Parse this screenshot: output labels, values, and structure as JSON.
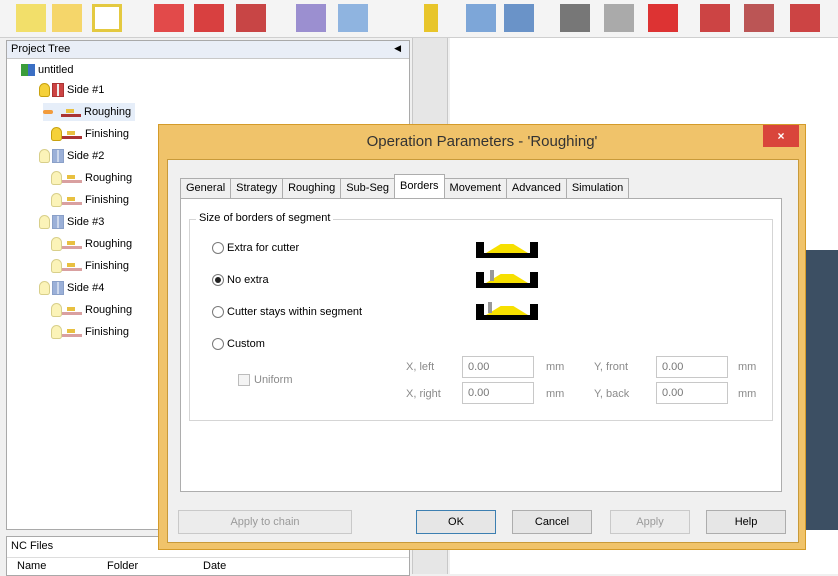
{
  "project_tree": {
    "title": "Project Tree",
    "root": "untitled",
    "sides": [
      {
        "label": "Side #1",
        "ops": [
          "Roughing",
          "Finishing"
        ]
      },
      {
        "label": "Side #2",
        "ops": [
          "Roughing",
          "Finishing"
        ]
      },
      {
        "label": "Side #3",
        "ops": [
          "Roughing",
          "Finishing"
        ]
      },
      {
        "label": "Side #4",
        "ops": [
          "Roughing",
          "Finishing"
        ]
      }
    ]
  },
  "nc_files": {
    "title": "NC Files",
    "columns": [
      "Name",
      "Folder",
      "Date"
    ]
  },
  "dialog": {
    "title": "Operation Parameters - 'Roughing'",
    "close_label": "×",
    "tabs": [
      "General",
      "Strategy",
      "Roughing",
      "Sub-Seg",
      "Borders",
      "Movement",
      "Advanced",
      "Simulation"
    ],
    "active_tab": "Borders",
    "group_title": "Size of borders of segment",
    "options": [
      "Extra for cutter",
      "No extra",
      "Cutter stays within segment",
      "Custom"
    ],
    "selected_option": "No extra",
    "uniform_label": "Uniform",
    "fields": {
      "x_left": {
        "label": "X, left",
        "value": "0.00",
        "unit": "mm"
      },
      "y_front": {
        "label": "Y, front",
        "value": "0.00",
        "unit": "mm"
      },
      "x_right": {
        "label": "X, right",
        "value": "0.00",
        "unit": "mm"
      },
      "y_back": {
        "label": "Y, back",
        "value": "0.00",
        "unit": "mm"
      }
    },
    "buttons": {
      "apply_chain": "Apply to chain",
      "ok": "OK",
      "cancel": "Cancel",
      "apply": "Apply",
      "help": "Help"
    }
  },
  "colors": {
    "dialog_frame": "#f0c36a",
    "close_button": "#d9453b",
    "material": "#f7e000"
  }
}
